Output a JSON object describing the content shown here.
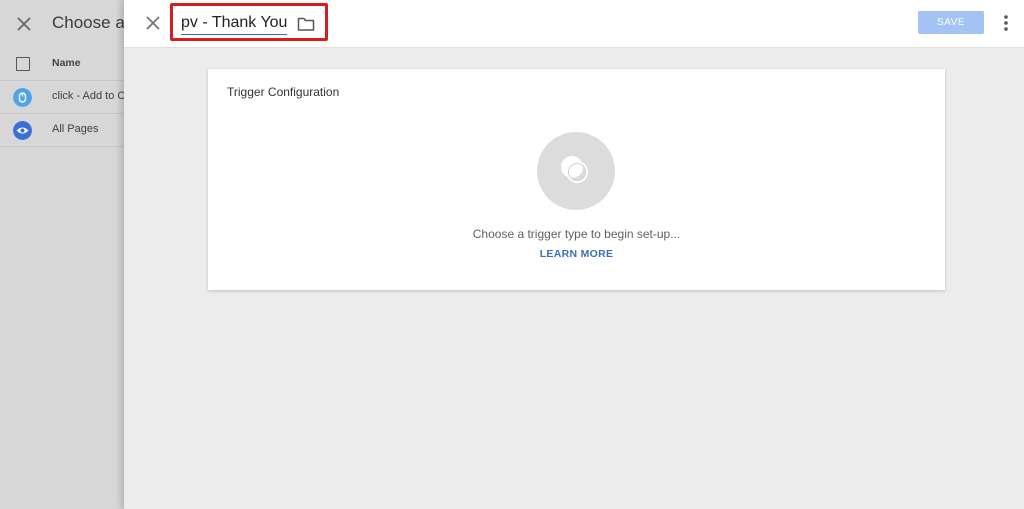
{
  "background": {
    "title": "Choose a",
    "header_label": "Name",
    "rows": [
      {
        "label": "click - Add to C",
        "icon": "cursor-icon",
        "color": "#4fa3e8"
      },
      {
        "label": "All Pages",
        "icon": "eye-icon",
        "color": "#3b6fd8"
      }
    ]
  },
  "header": {
    "name_value": "pv - Thank You",
    "save_label": "SAVE"
  },
  "card": {
    "title": "Trigger Configuration",
    "hint": "Choose a trigger type to begin set-up...",
    "learn_more": "LEARN MORE"
  },
  "colors": {
    "accent": "#3367d6",
    "highlight": "#d71e1e",
    "save_disabled": "#a4c2f4"
  }
}
